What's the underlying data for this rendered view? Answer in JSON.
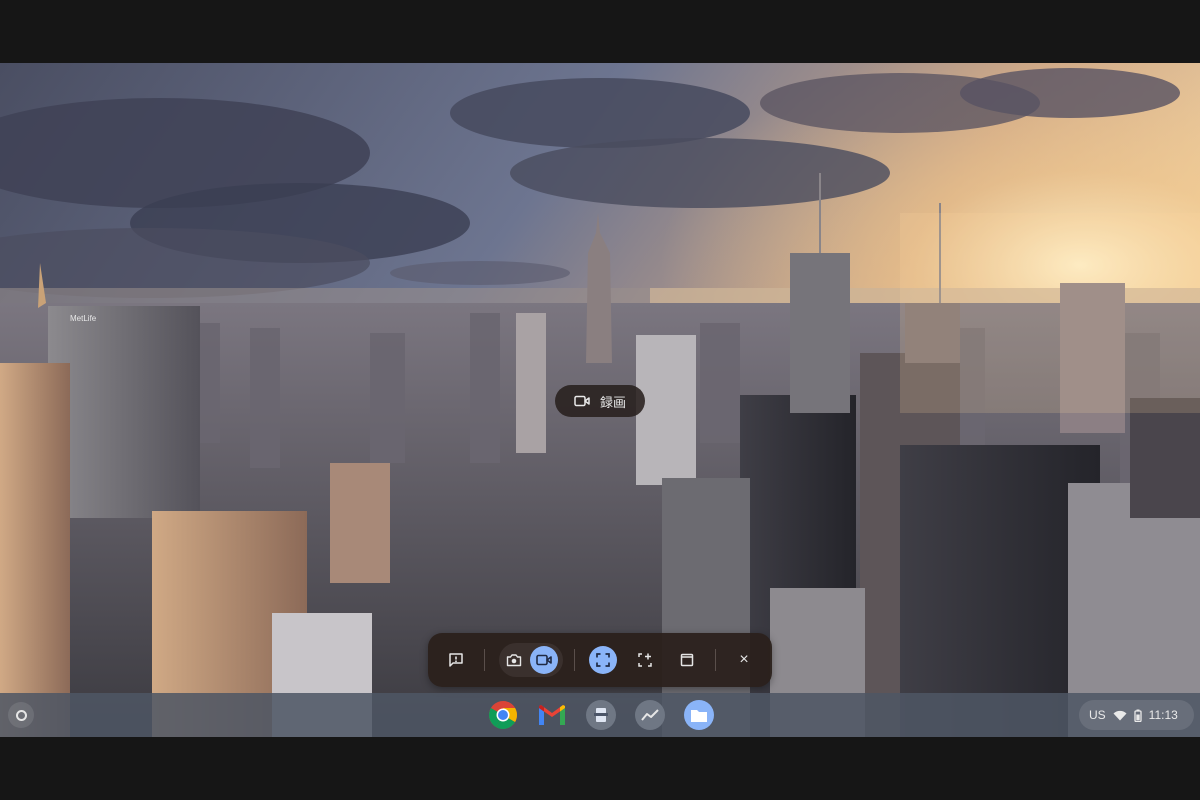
{
  "recording": {
    "label": "録画"
  },
  "capture_toolbar": {
    "buttons": [
      {
        "name": "feedback",
        "icon": "feedback-icon"
      },
      {
        "name": "screenshot-mode",
        "icon": "camera-icon"
      },
      {
        "name": "screen-record-mode",
        "icon": "videocam-icon",
        "active": true
      },
      {
        "name": "full-screen-capture",
        "icon": "fullscreen-icon",
        "active": true
      },
      {
        "name": "partial-capture",
        "icon": "crop-add-icon"
      },
      {
        "name": "window-capture",
        "icon": "window-icon"
      },
      {
        "name": "close",
        "icon": "close-icon"
      }
    ],
    "close_glyph": "×"
  },
  "shelf": {
    "apps": [
      {
        "name": "Chrome",
        "icon": "chrome-icon"
      },
      {
        "name": "Gmail",
        "icon": "gmail-icon"
      },
      {
        "name": "Docs Scanner",
        "icon": "scanner-icon"
      },
      {
        "name": "Stats",
        "icon": "trend-icon"
      },
      {
        "name": "Files",
        "icon": "folder-icon"
      }
    ],
    "status": {
      "ime": "US",
      "time": "11:13"
    }
  },
  "colors": {
    "accent": "#8ab4f8",
    "shelf": "#4e5664",
    "toolbar": "#2b201c"
  }
}
